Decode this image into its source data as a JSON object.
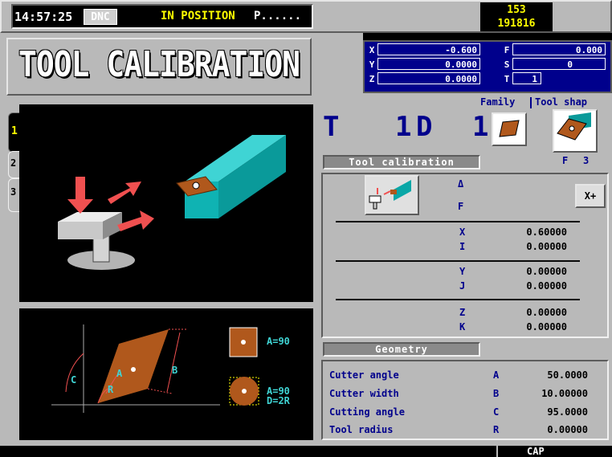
{
  "status_bar": {
    "time": "14:57:25",
    "mode_badge": "DNC",
    "status": "IN POSITION",
    "program": "P......",
    "counter_top": "153",
    "counter_bottom": "191816"
  },
  "title": "TOOL CALIBRATION",
  "positions": {
    "left": [
      {
        "axis": "X",
        "value": "-0.600"
      },
      {
        "axis": "Y",
        "value": "0.0000"
      },
      {
        "axis": "Z",
        "value": "0.0000"
      }
    ],
    "right": [
      {
        "axis": "F",
        "value": "0.000"
      },
      {
        "axis": "S",
        "value": "0"
      },
      {
        "axis": "T",
        "value": "1"
      }
    ]
  },
  "family_label": "Family",
  "tool_shape_label": "Tool shap",
  "tool_line": {
    "t": "T",
    "tool_number": "1",
    "d": "D",
    "d_number": "1"
  },
  "shape_code": {
    "letter": "F",
    "number": "3"
  },
  "side_tabs": [
    "1",
    "2",
    "3"
  ],
  "calibration": {
    "header": "Tool calibration",
    "delta_label": "Δ",
    "f_label": "F",
    "direction_button": "X+",
    "rows": [
      {
        "label": "X",
        "value": "0.60000"
      },
      {
        "label": "I",
        "value": "0.00000"
      },
      {
        "label": "Y",
        "value": "0.00000"
      },
      {
        "label": "J",
        "value": "0.00000"
      },
      {
        "label": "Z",
        "value": "0.00000"
      },
      {
        "label": "K",
        "value": "0.00000"
      }
    ]
  },
  "geometry": {
    "header": "Geometry",
    "rows": [
      {
        "name": "Cutter angle",
        "code": "A",
        "value": "50.0000"
      },
      {
        "name": "Cutter width",
        "code": "B",
        "value": "10.00000"
      },
      {
        "name": "Cutting angle",
        "code": "C",
        "value": "95.0000"
      },
      {
        "name": "Tool radius",
        "code": "R",
        "value": "0.00000"
      }
    ]
  },
  "diagram": {
    "letter_a": "A",
    "letter_b": "B",
    "letter_c": "C",
    "letter_r": "R",
    "square_label": "A=90",
    "round_label_1": "A=90",
    "round_label_2": "D=2R"
  },
  "bottom_bar": {
    "cap": "CAP"
  },
  "colors": {
    "brown": "#b0581c",
    "teal": "#0aa7a7",
    "red": "#f05050",
    "navy": "#00008c",
    "yellow": "#ffff00"
  }
}
